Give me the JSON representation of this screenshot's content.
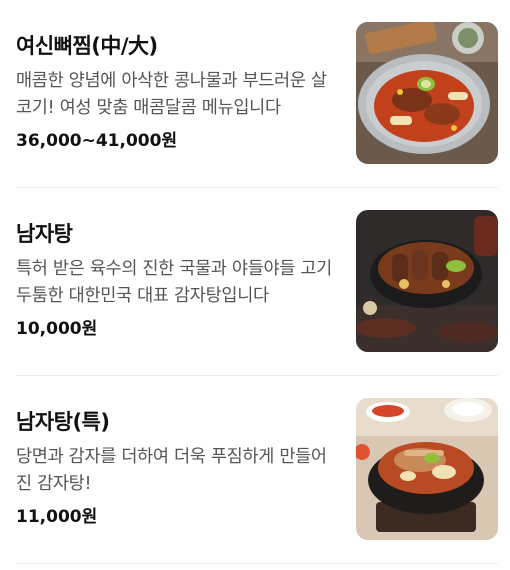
{
  "menu": {
    "items": [
      {
        "name": "여신뼈찜(中/大)",
        "description": "매콤한 양념에 아삭한 콩나물과 부드러운 살코기! 여성 맞춤 매콤달콤 메뉴입니다",
        "price": "36,000~41,000원",
        "image": "braised-pork-bone-dish-image"
      },
      {
        "name": "남자탕",
        "description": "특허 받은 육수의 진한 국물과 야들야들 고기 두툼한 대한민국 대표 감자탕입니다",
        "price": "10,000원",
        "image": "pork-bone-soup-image"
      },
      {
        "name": "남자탕(특)",
        "description": "당면과 감자를 더하여 더욱 푸짐하게 만들어진 감자탕!",
        "price": "11,000원",
        "image": "special-pork-bone-soup-image"
      }
    ]
  }
}
